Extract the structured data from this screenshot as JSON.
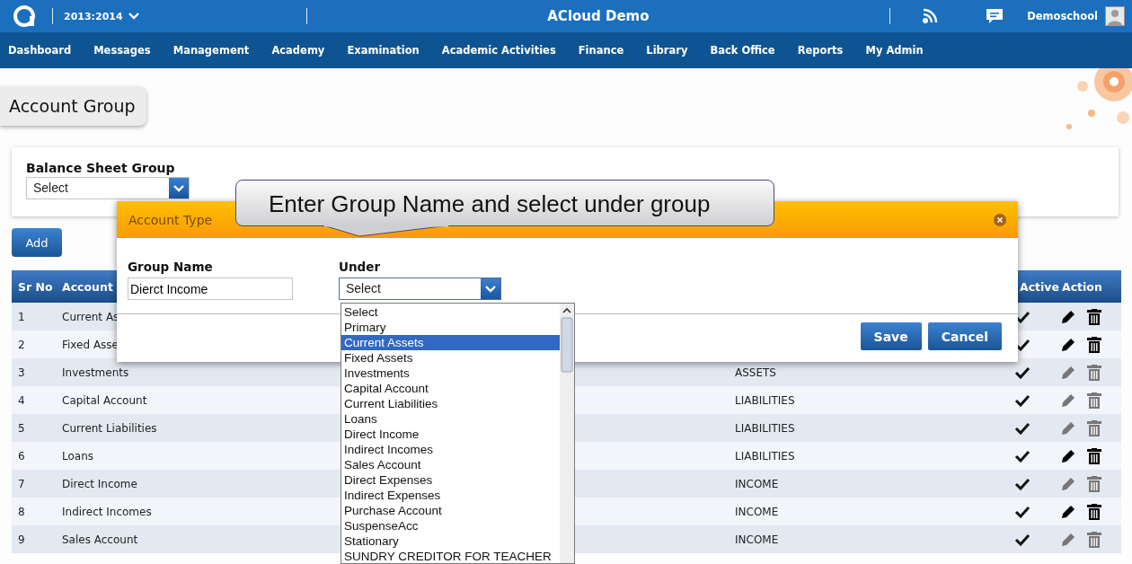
{
  "header": {
    "year": "2013:2014",
    "title": "ACloud Demo",
    "user": "Demoschool"
  },
  "nav": [
    "Dashboard",
    "Messages",
    "Management",
    "Academy",
    "Examination",
    "Academic Activities",
    "Finance",
    "Library",
    "Back Office",
    "Reports",
    "My Admin"
  ],
  "page_title": "Account Group",
  "filter": {
    "label": "Balance Sheet Group",
    "value": "Select"
  },
  "add_button": "Add",
  "table": {
    "columns": [
      "Sr No",
      "Account",
      "Active",
      "Action"
    ],
    "rows": [
      {
        "sr": "1",
        "name": "Current As",
        "active": true,
        "editable": true
      },
      {
        "sr": "2",
        "name": "Fixed Asse",
        "active": true,
        "editable": true
      },
      {
        "sr": "3",
        "name": "Investments",
        "group": "ASSETS",
        "active": true,
        "editable": false
      },
      {
        "sr": "4",
        "name": "Capital Account",
        "group": "LIABILITIES",
        "active": true,
        "editable": false
      },
      {
        "sr": "5",
        "name": "Current Liabilities",
        "group": "LIABILITIES",
        "active": true,
        "editable": false
      },
      {
        "sr": "6",
        "name": "Loans",
        "group": "LIABILITIES",
        "active": true,
        "editable": true
      },
      {
        "sr": "7",
        "name": "Direct Income",
        "group": "INCOME",
        "active": true,
        "editable": false
      },
      {
        "sr": "8",
        "name": "Indirect Incomes",
        "group": "INCOME",
        "active": true,
        "editable": true
      },
      {
        "sr": "9",
        "name": "Sales Account",
        "group": "INCOME",
        "active": true,
        "editable": false
      }
    ]
  },
  "modal": {
    "title": "Account Type",
    "group_name": {
      "label": "Group Name",
      "value": "Dierct Income"
    },
    "under": {
      "label": "Under",
      "value": "Select"
    },
    "buttons": [
      "Save",
      "Cancel"
    ]
  },
  "dropdown": [
    {
      "label": "Select",
      "selected": false
    },
    {
      "label": "Primary",
      "selected": false
    },
    {
      "label": "Current Assets",
      "selected": true
    },
    {
      "label": "Fixed Assets",
      "selected": false
    },
    {
      "label": "Investments",
      "selected": false
    },
    {
      "label": "Capital Account",
      "selected": false
    },
    {
      "label": "Current Liabilities",
      "selected": false
    },
    {
      "label": "Loans",
      "selected": false
    },
    {
      "label": "Direct Income",
      "selected": false
    },
    {
      "label": "Indirect Incomes",
      "selected": false
    },
    {
      "label": "Sales Account",
      "selected": false
    },
    {
      "label": "Direct Expenses",
      "selected": false
    },
    {
      "label": "Indirect Expenses",
      "selected": false
    },
    {
      "label": "Purchase Account",
      "selected": false
    },
    {
      "label": "SuspenseAcc",
      "selected": false
    },
    {
      "label": "Stationary",
      "selected": false
    },
    {
      "label": "SUNDRY CREDITOR FOR TEACHER",
      "selected": false
    }
  ],
  "callout": "Enter Group Name and select under group"
}
